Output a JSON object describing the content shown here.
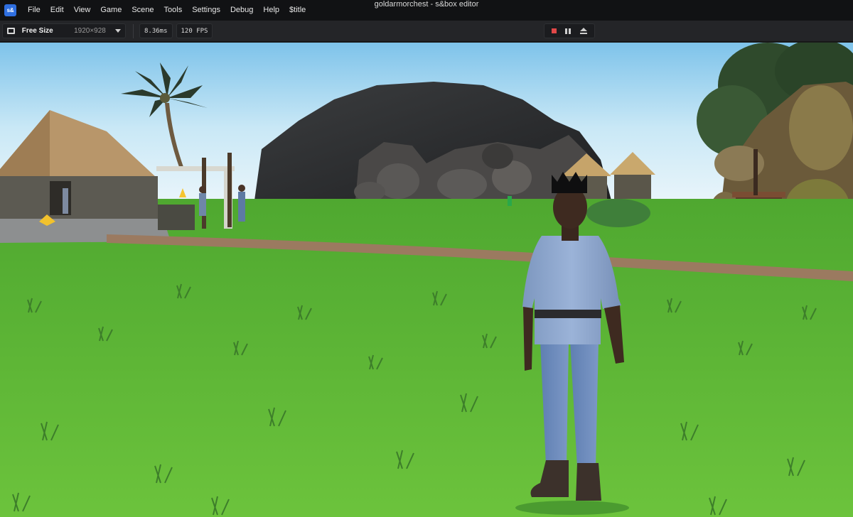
{
  "app": {
    "logo_text": "s&",
    "window_title": "goldarmorchest - s&box editor"
  },
  "menu": {
    "items": [
      "File",
      "Edit",
      "View",
      "Game",
      "Scene",
      "Tools",
      "Settings",
      "Debug",
      "Help",
      "$title"
    ]
  },
  "toolbar": {
    "size_label": "Free Size",
    "size_dims": "1920×928",
    "frame_time": "8.36ms",
    "fps": "120 FPS"
  },
  "icons": {
    "logo": "sbox-logo-icon",
    "viewport_frame": "frame-icon",
    "dropdown": "chevron-down-icon",
    "stop": "stop-icon",
    "pause": "pause-icon",
    "eject": "eject-icon"
  },
  "colors": {
    "menubar_bg": "#111214",
    "toolbar_bg": "#242528",
    "accent_logo": "#2f6fe0",
    "stop_red": "#e04848",
    "sky": "#bfe3f5",
    "grass": "#5fb83a"
  }
}
